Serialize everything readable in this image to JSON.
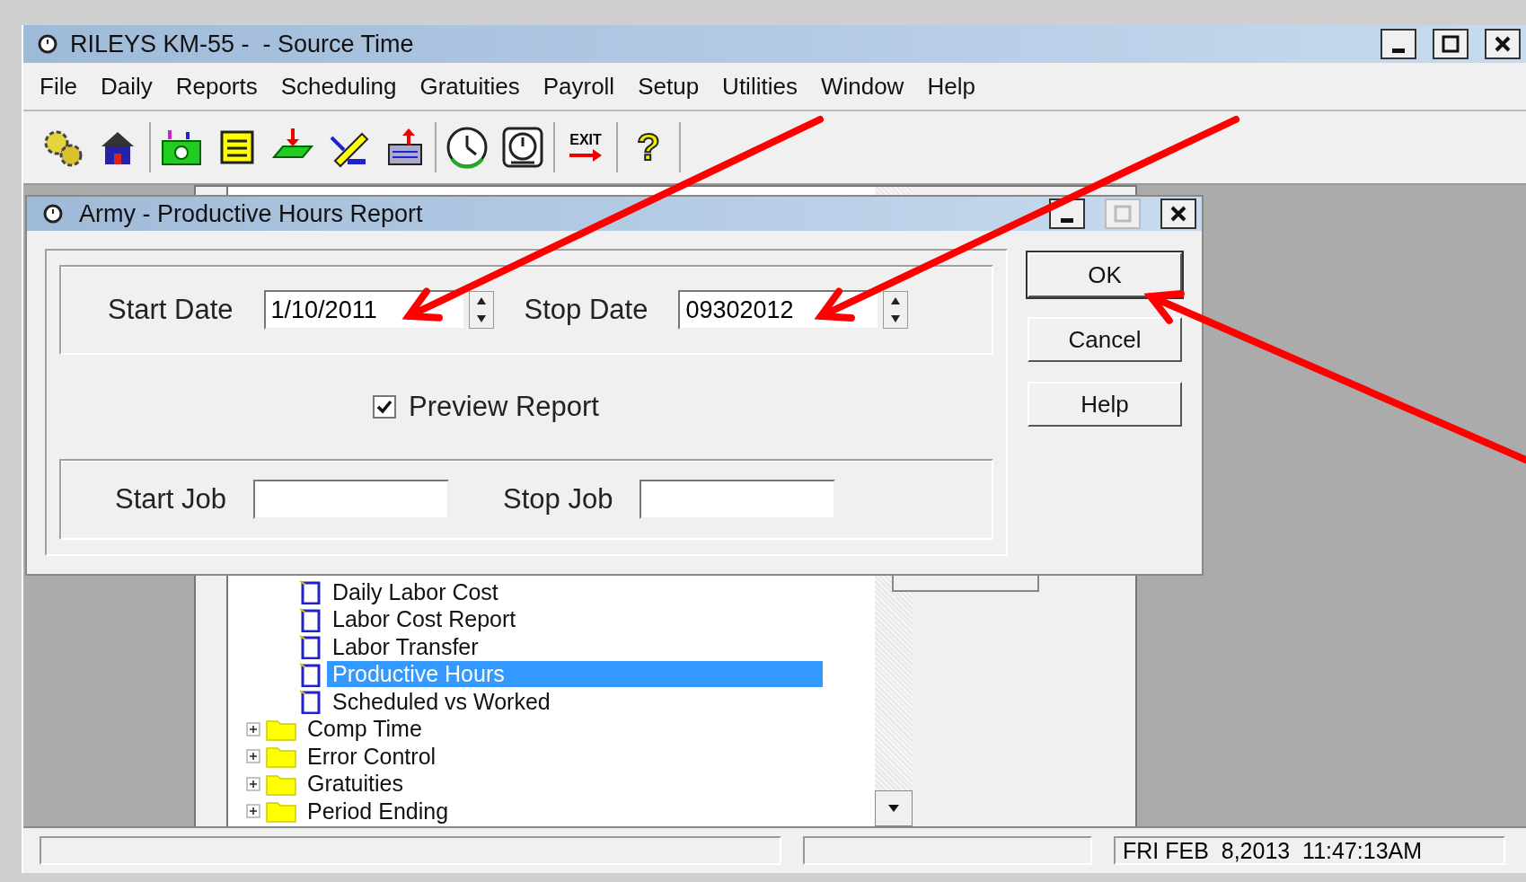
{
  "window": {
    "title": "RILEYS KM-55 -  - Source Time"
  },
  "menu": [
    "File",
    "Daily",
    "Reports",
    "Scheduling",
    "Gratuities",
    "Payroll",
    "Setup",
    "Utilities",
    "Window",
    "Help"
  ],
  "toolbar": [
    {
      "kind": "gears"
    },
    {
      "kind": "house"
    },
    {
      "kind": "money"
    },
    {
      "kind": "notepad"
    },
    {
      "kind": "download"
    },
    {
      "kind": "edit"
    },
    {
      "kind": "upload"
    },
    {
      "kind": "clock"
    },
    {
      "kind": "timer"
    },
    {
      "kind": "exit",
      "label": "EXIT"
    },
    {
      "kind": "help",
      "label": "?"
    }
  ],
  "tree": [
    {
      "children": [
        {
          "label": "Daily Labor Cost",
          "kind": "report",
          "selected": false
        },
        {
          "label": "Labor Cost Report",
          "kind": "report",
          "selected": false
        },
        {
          "label": "Labor Transfer",
          "kind": "report",
          "selected": false
        },
        {
          "label": "Productive Hours",
          "kind": "report",
          "selected": true
        },
        {
          "label": "Scheduled vs Worked",
          "kind": "report",
          "selected": false
        }
      ]
    },
    {
      "label": "Comp Time",
      "kind": "folder",
      "expanded": false,
      "selected": false
    },
    {
      "label": "Error Control",
      "kind": "folder",
      "expanded": false,
      "selected": false
    },
    {
      "label": "Gratuities",
      "kind": "folder",
      "expanded": false,
      "selected": false
    },
    {
      "label": "Period Ending",
      "kind": "folder",
      "expanded": false,
      "selected": false
    }
  ],
  "dialog": {
    "title": "Army - Productive Hours Report",
    "start_date": {
      "label": "Start Date",
      "value": "1/10/2011"
    },
    "stop_date": {
      "label": "Stop Date",
      "value": "09302012"
    },
    "preview": {
      "label": "Preview Report",
      "checked": true
    },
    "start_job": {
      "label": "Start Job"
    },
    "stop_job": {
      "label": "Stop Job"
    },
    "buttons": [
      {
        "label": "OK",
        "focused": true
      },
      {
        "label": "Cancel",
        "focused": false
      },
      {
        "label": "Help",
        "focused": false
      }
    ]
  },
  "status_bar": {
    "pane_3": "FRI FEB  8,2013  11:47:13AM"
  }
}
